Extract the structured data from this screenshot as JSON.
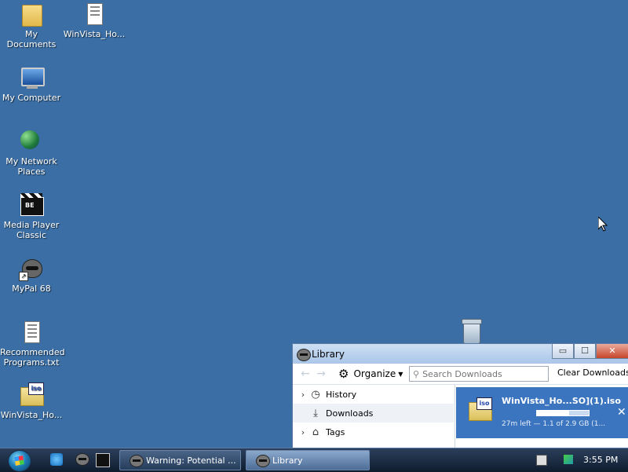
{
  "desktop": {
    "icons": [
      {
        "label": "My Documents",
        "icon": "folder-icon"
      },
      {
        "label": "WinVista_Ho...",
        "icon": "document-icon"
      },
      {
        "label": "My Computer",
        "icon": "computer-icon"
      },
      {
        "label": "My Network Places",
        "icon": "network-icon"
      },
      {
        "label": "Media Player Classic",
        "icon": "media-player-icon"
      },
      {
        "label": "MyPal 68",
        "icon": "raccoon-icon"
      },
      {
        "label": "Recommended Programs.txt",
        "icon": "text-file-icon"
      },
      {
        "label": "WinVista_Ho...",
        "icon": "iso-file-icon"
      }
    ],
    "background_color": "#3a6ea5"
  },
  "library_window": {
    "title": "Library",
    "controls": {
      "minimize": "▭",
      "maximize": "☐",
      "close": "✕"
    },
    "toolbar": {
      "back": "←",
      "forward": "→",
      "organize_label": "Organize",
      "search_placeholder": "Search Downloads",
      "clear_label": "Clear Downloads"
    },
    "sidebar": [
      {
        "label": "History",
        "chevron": "›",
        "icon": "clock-icon"
      },
      {
        "label": "Downloads",
        "chevron": "",
        "icon": "download-icon",
        "selected": true
      },
      {
        "label": "Tags",
        "chevron": "›",
        "icon": "tag-icon"
      }
    ],
    "download": {
      "filename": "WinVista_Ho...SO](1).iso",
      "status": "27m left — 1.1 of 2.9 GB (1...",
      "progress_percent": 38,
      "icon_text": "iso",
      "cancel": "✕"
    }
  },
  "taskbar": {
    "tasks": [
      {
        "label": "Warning: Potential ...",
        "active": false
      },
      {
        "label": "Library",
        "active": true
      }
    ],
    "clock": "3:55 PM"
  }
}
